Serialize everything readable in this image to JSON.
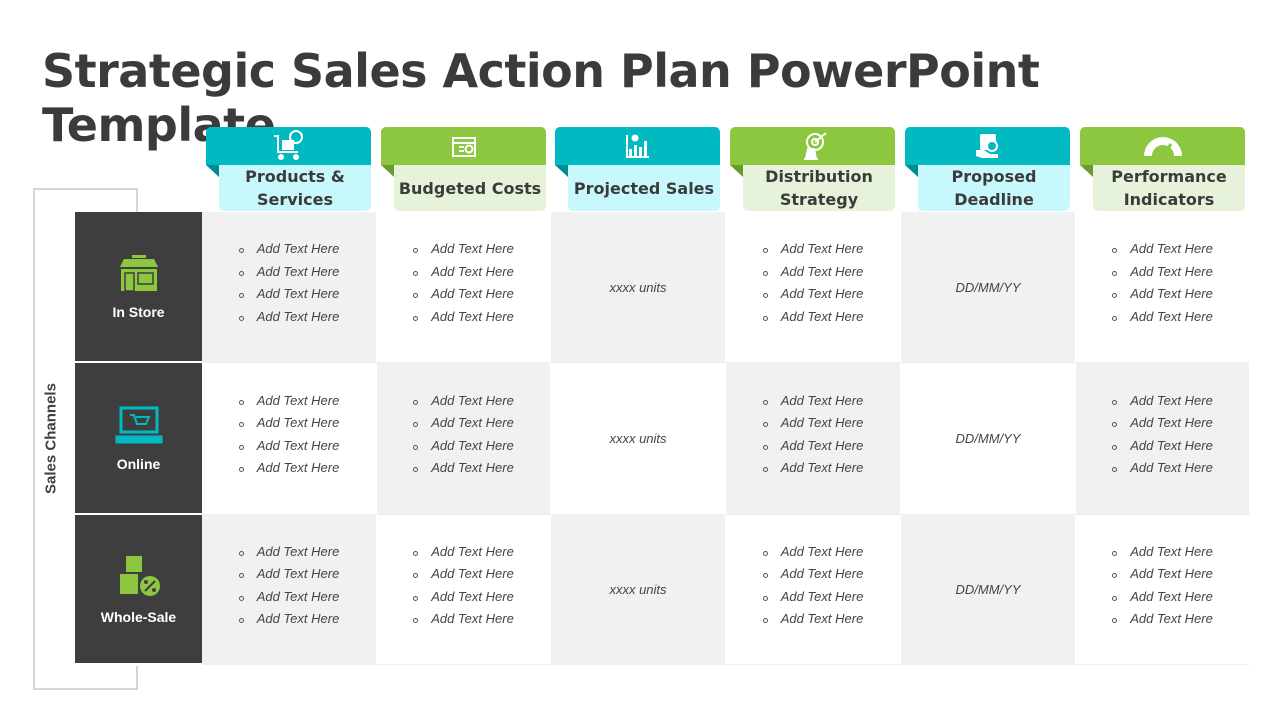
{
  "title": "Strategic Sales Action Plan PowerPoint Template",
  "side_label": "Sales Channels",
  "colors": {
    "teal": "#00b9c1",
    "teal_light": "#c7f8fc",
    "green": "#8dc63f",
    "green_light": "#e7f2da",
    "dark": "#3e3e3e"
  },
  "columns": [
    {
      "label": "Products & Services",
      "icon": "cart-box-icon",
      "theme": "teal"
    },
    {
      "label": "Budgeted Costs",
      "icon": "calendar-dollar-icon",
      "theme": "green"
    },
    {
      "label": "Projected Sales",
      "icon": "chart-dollar-icon",
      "theme": "teal"
    },
    {
      "label": "Distribution Strategy",
      "icon": "target-chess-icon",
      "theme": "green"
    },
    {
      "label": "Proposed Deadline",
      "icon": "schedule-hand-icon",
      "theme": "teal"
    },
    {
      "label": "Performance Indicators",
      "icon": "gauge-icon",
      "theme": "green"
    }
  ],
  "rows": [
    {
      "label": "In Store",
      "icon": "store-icon"
    },
    {
      "label": "Online",
      "icon": "laptop-cart-icon"
    },
    {
      "label": "Whole-Sale",
      "icon": "boxes-percent-icon"
    }
  ],
  "bullet_text": "Add Text Here",
  "units_text": "xxxx units",
  "date_text": "DD/MM/YY"
}
